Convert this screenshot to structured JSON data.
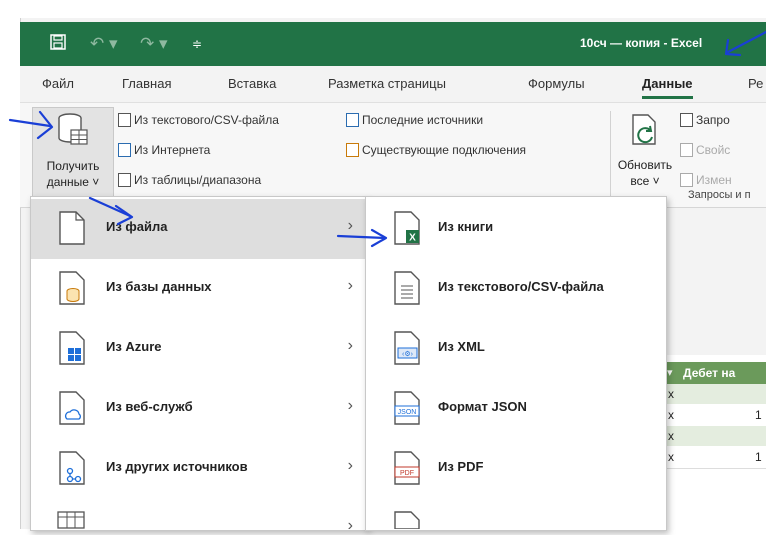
{
  "window": {
    "title": "10сч — копия - Excel",
    "undo_icon": "undo-icon",
    "redo_icon": "redo-icon",
    "save_icon": "save-icon",
    "colors": {
      "titlebar": "#217346",
      "accent": "#217346",
      "annotation": "#1a3fd6"
    }
  },
  "tabs": [
    "Файл",
    "Главная",
    "Вставка",
    "Разметка страницы",
    "Формулы",
    "Данные",
    "Ре"
  ],
  "active_tab": "Данные",
  "ribbon": {
    "get_data": {
      "line1": "Получить",
      "line2": "данные ˅"
    },
    "from_text_csv": "Из текстового/CSV-файла",
    "from_web": "Из Интернета",
    "from_table": "Из таблицы/диапазона",
    "recent_sources": "Последние источники",
    "existing_connections": "Существующие подключения",
    "refresh_all": {
      "line1": "Обновить",
      "line2": "все ˅"
    },
    "queries": "Запро",
    "properties": "Свойс",
    "edit_links": "Измен",
    "group_label": "Запросы и п"
  },
  "menu_primary": [
    {
      "label": "Из файла",
      "icon": "file-icon",
      "highlighted": true
    },
    {
      "label": "Из базы данных",
      "icon": "database-icon",
      "highlighted": false
    },
    {
      "label": "Из Azure",
      "icon": "azure-icon",
      "highlighted": false
    },
    {
      "label": "Из веб-служб",
      "icon": "web-service-icon",
      "highlighted": false
    },
    {
      "label": "Из других источников",
      "icon": "other-sources-icon",
      "highlighted": false
    }
  ],
  "menu_secondary": [
    {
      "label": "Из книги",
      "icon": "excel-workbook-icon"
    },
    {
      "label": "Из текстового/CSV-файла",
      "icon": "text-file-icon"
    },
    {
      "label": "Из XML",
      "icon": "xml-icon"
    },
    {
      "label": "Формат JSON",
      "icon": "json-icon"
    },
    {
      "label": "Из PDF",
      "icon": "pdf-icon"
    }
  ],
  "grid": {
    "header": "Дебет на",
    "rows": [
      {
        "left": "x",
        "right": ""
      },
      {
        "left": "x",
        "right": "1"
      },
      {
        "left": "x",
        "right": ""
      },
      {
        "left": "x",
        "right": "1"
      }
    ]
  }
}
